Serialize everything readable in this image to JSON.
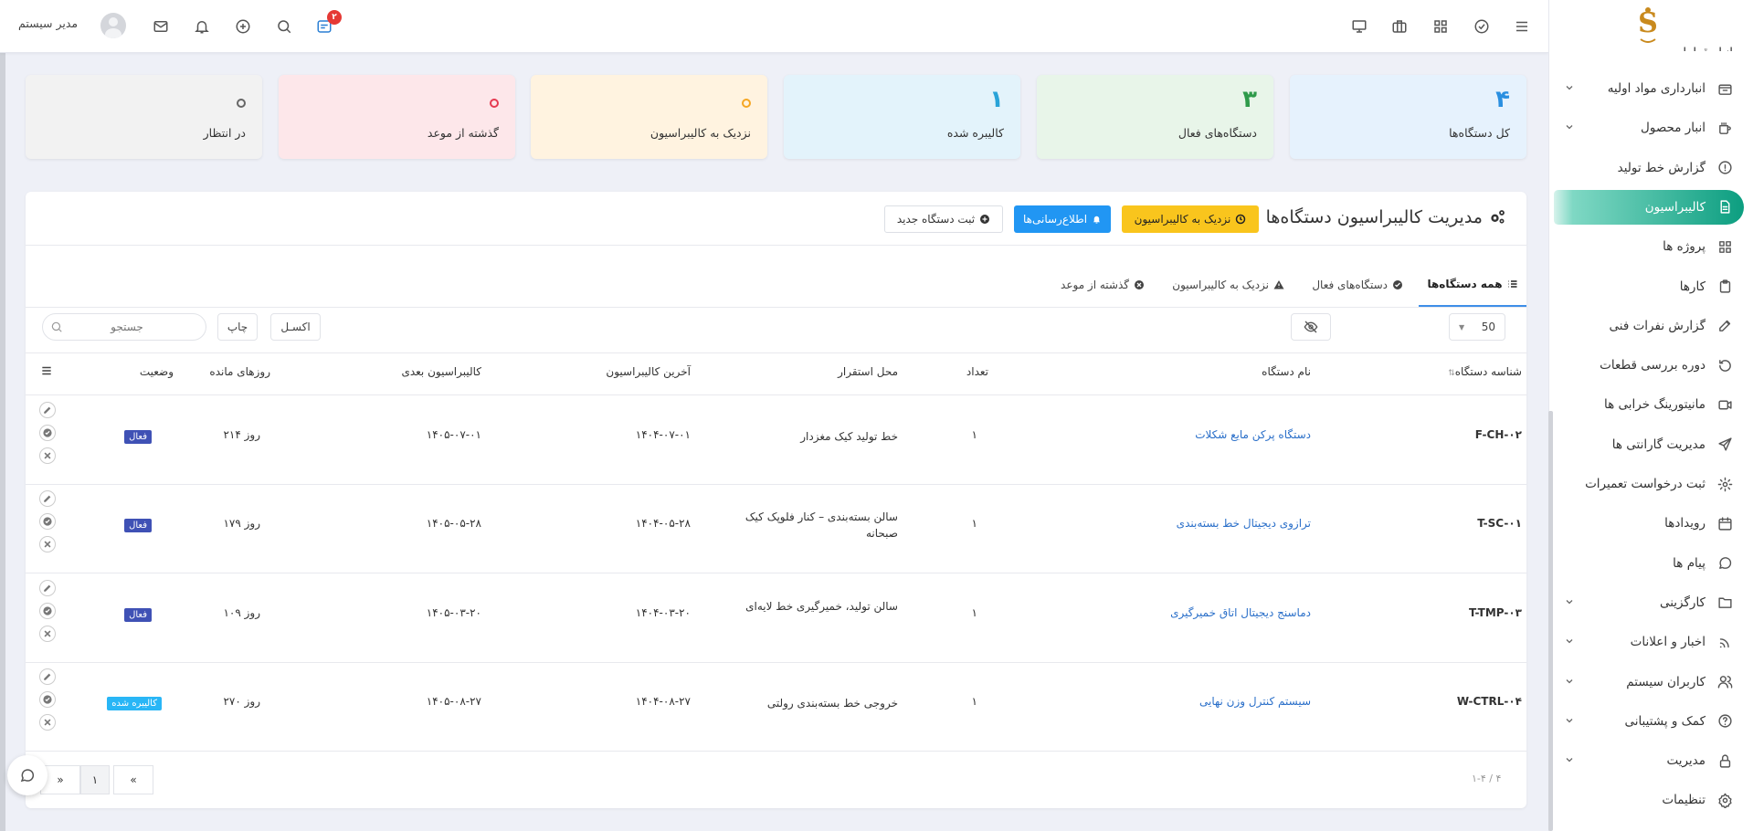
{
  "header": {
    "user_name": "مدیر سیستم",
    "notifications_count": "۲"
  },
  "sidebar": {
    "partial_top": "انبار قطعات",
    "items": [
      {
        "label": "انبارداری مواد اولیه",
        "icon": "box-icon",
        "chevron": true
      },
      {
        "label": "انبار محصول",
        "icon": "package-icon",
        "chevron": true
      },
      {
        "label": "گزارش خط تولید",
        "icon": "alert-circle-icon",
        "chevron": false
      },
      {
        "label": "کالیبراسیون",
        "icon": "file-icon",
        "chevron": false,
        "active": true
      },
      {
        "label": "پروژه ها",
        "icon": "grid-icon",
        "chevron": false
      },
      {
        "label": "کارها",
        "icon": "clipboard-icon",
        "chevron": false
      },
      {
        "label": "گزارش نفرات فنی",
        "icon": "edit-icon",
        "chevron": false
      },
      {
        "label": "دوره بررسی قطعات",
        "icon": "rotate-icon",
        "chevron": false
      },
      {
        "label": "مانیتورینگ خرابی ها",
        "icon": "video-icon",
        "chevron": false
      },
      {
        "label": "مدیریت گارانتی ها",
        "icon": "send-icon",
        "chevron": false
      },
      {
        "label": "ثبت درخواست تعمیرات",
        "icon": "settings-icon",
        "chevron": false
      },
      {
        "label": "رویدادها",
        "icon": "calendar-icon",
        "chevron": false
      },
      {
        "label": "پیام ها",
        "icon": "message-icon",
        "chevron": false
      },
      {
        "label": "کارگزینی",
        "icon": "folder-icon",
        "chevron": true
      },
      {
        "label": "اخبار و اعلانات",
        "icon": "rss-icon",
        "chevron": true
      },
      {
        "label": "کاربران سیستم",
        "icon": "users-icon",
        "chevron": true
      },
      {
        "label": "کمک و پشتیبانی",
        "icon": "help-icon",
        "chevron": true
      },
      {
        "label": "مدیریت",
        "icon": "lock-icon",
        "chevron": true
      },
      {
        "label": "تنظیمات",
        "icon": "gear-icon",
        "chevron": false
      }
    ]
  },
  "stats": [
    {
      "label": "کل دستگاه‌ها",
      "value": "۴",
      "bg": "#e6f2fd",
      "color": "#2a8fe0"
    },
    {
      "label": "دستگاه‌های فعال",
      "value": "۳",
      "bg": "#e8f5e9",
      "color": "#2e9a4a"
    },
    {
      "label": "کالیبره شده",
      "value": "۱",
      "bg": "#e3f3fb",
      "color": "#29a3d8"
    },
    {
      "label": "نزدیک به کالیبراسیون",
      "value": "۰",
      "bg": "#fff3e0",
      "color": "#f5a623"
    },
    {
      "label": "گذشته از موعد",
      "value": "۰",
      "bg": "#fde7ea",
      "color": "#e53950"
    },
    {
      "label": "در انتظار",
      "value": "۰",
      "bg": "#f2f2f2",
      "color": "#666666"
    }
  ],
  "page": {
    "title": "مدیریت کالیبراسیون دستگاه‌ها",
    "btn_near": "نزدیک به کالیبراسیون",
    "btn_notify": "اطلاع‌رسانی‌ها",
    "btn_new": "ثبت دستگاه جدید"
  },
  "tabs": [
    "همه دستگاه‌ها",
    "دستگاه‌های فعال",
    "نزدیک به کالیبراسیون",
    "گذشته از موعد"
  ],
  "toolbar": {
    "page_size": "50",
    "excel": "اکسـل",
    "print": "چاپ",
    "search_placeholder": "جستجو"
  },
  "table": {
    "headers": [
      "شناسه دستگاه",
      "نام دستگاه",
      "تعداد",
      "محل استقرار",
      "آخرین کالیبراسیون",
      "کالیبراسیون بعدی",
      "روزهای مانده",
      "وضعیت"
    ],
    "rows": [
      {
        "id": "F-CH-۰۲",
        "name": "دستگاه پرکن مایع شکلات",
        "qty": "۱",
        "location": "خط تولید کیک مغزدار",
        "last": "۱۴۰۴-۰۷-۰۱",
        "next": "۱۴۰۵-۰۷-۰۱",
        "days": "۲۱۴ روز",
        "status": "فعال",
        "status_color": "#3f51b5"
      },
      {
        "id": "T-SC-۰۱",
        "name": "ترازوی دیجیتال خط بسته‌بندی",
        "qty": "۱",
        "location": "سالن بسته‌بندی – کنار فلوپک کیک صبحانه",
        "last": "۱۴۰۴-۰۵-۲۸",
        "next": "۱۴۰۵-۰۵-۲۸",
        "days": "۱۷۹ روز",
        "status": "فعال",
        "status_color": "#3f51b5"
      },
      {
        "id": "T-TMP-۰۳",
        "name": "دماسنج دیجیتال اتاق خمیرگیری",
        "qty": "۱",
        "location": "سالن تولید، خمیرگیری خط لایه‌ای",
        "last": "۱۴۰۴-۰۳-۲۰",
        "next": "۱۴۰۵-۰۳-۲۰",
        "days": "۱۰۹ روز",
        "status": "فعال",
        "status_color": "#3f51b5"
      },
      {
        "id": "W-CTRL-۰۴",
        "name": "سیستم کنترل وزن نهایی",
        "qty": "۱",
        "location": "خروجی خط بسته‌بندی رولتی",
        "last": "۱۴۰۴-۰۸-۲۷",
        "next": "۱۴۰۵-۰۸-۲۷",
        "days": "۲۷۰ روز",
        "status": "کالیبره شده",
        "status_color": "#29b6f6"
      }
    ]
  },
  "pagination": {
    "info": "۱-۴ / ۴",
    "current": "۱",
    "prev": "«",
    "next": "»"
  }
}
